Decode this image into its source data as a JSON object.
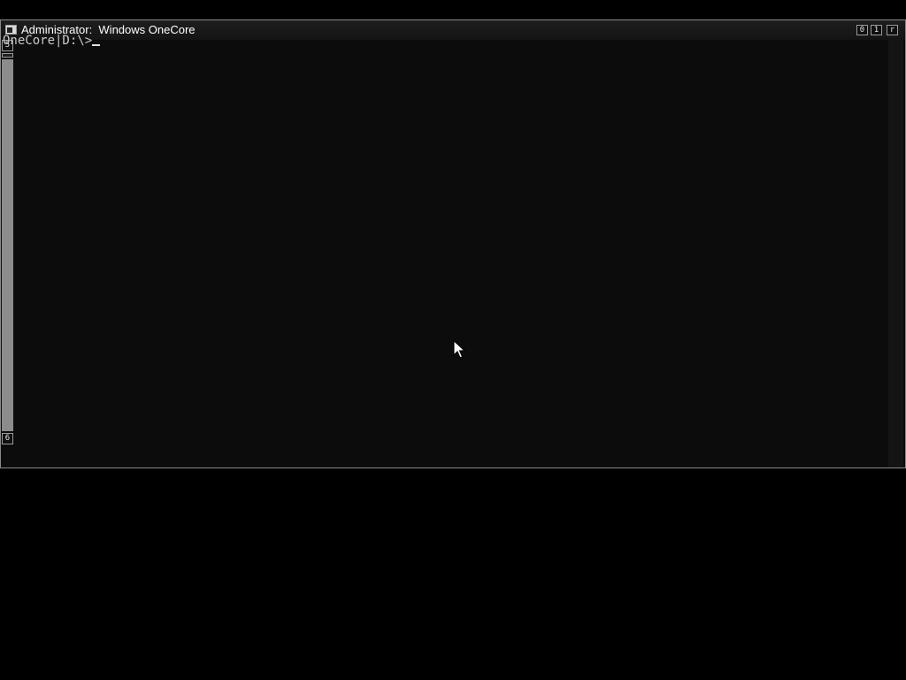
{
  "window": {
    "title": "Administrator:  Windows OneCore",
    "minimize_glyph": "0",
    "maximize_glyph": "1",
    "close_glyph": "r"
  },
  "console": {
    "prompt": "OneCore|D:\\>",
    "input_value": ""
  },
  "scrollbar": {
    "up_glyph": "5",
    "down_glyph": "6"
  },
  "icons": {
    "app": "console-app-icon",
    "pointer": "mouse-pointer-icon"
  },
  "colors": {
    "background": "#000000",
    "console_background": "#0c0c0c",
    "text": "#c8c8c8",
    "border": "#8a8a8a"
  }
}
